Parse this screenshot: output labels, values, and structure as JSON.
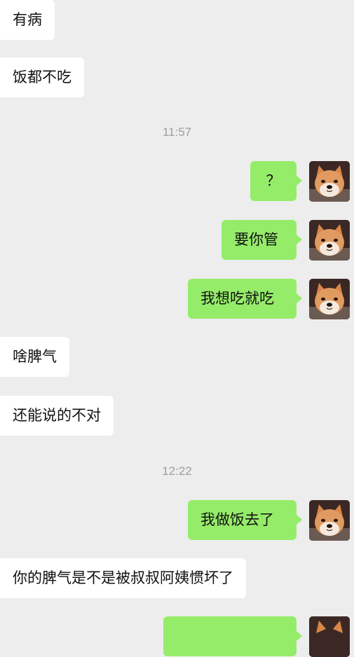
{
  "messages": [
    {
      "type": "incoming",
      "text": "有病"
    },
    {
      "type": "incoming",
      "text": "饭都不吃"
    },
    {
      "type": "timestamp",
      "text": "11:57"
    },
    {
      "type": "outgoing",
      "text": "？",
      "avatar": "shiba-dog-avatar"
    },
    {
      "type": "outgoing",
      "text": "要你管",
      "avatar": "shiba-dog-avatar"
    },
    {
      "type": "outgoing",
      "text": "我想吃就吃",
      "avatar": "shiba-dog-avatar"
    },
    {
      "type": "incoming",
      "text": "啥脾气"
    },
    {
      "type": "incoming",
      "text": "还能说的不对"
    },
    {
      "type": "timestamp",
      "text": "12:22"
    },
    {
      "type": "outgoing",
      "text": "我做饭去了",
      "avatar": "shiba-dog-avatar"
    },
    {
      "type": "incoming",
      "text": "你的脾气是不是被叔叔阿姨惯坏了"
    },
    {
      "type": "outgoing",
      "text": "",
      "avatar": "shiba-dog-avatar"
    }
  ],
  "colors": {
    "background": "#ededed",
    "incoming_bubble": "#ffffff",
    "outgoing_bubble": "#95ec69",
    "timestamp_text": "#9e9e9e"
  }
}
